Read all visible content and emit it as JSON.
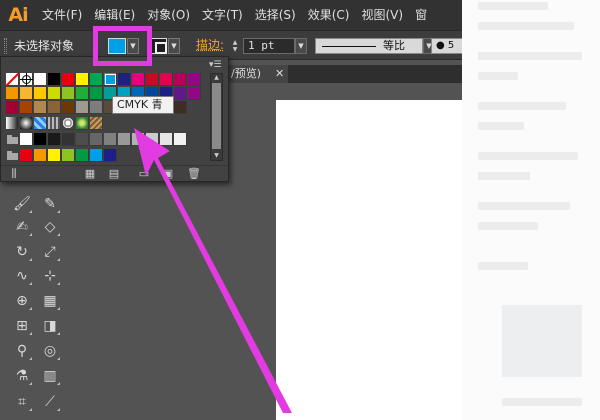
{
  "app": {
    "logo": "Ai"
  },
  "menubar": {
    "items": [
      "文件(F)",
      "编辑(E)",
      "对象(O)",
      "文字(T)",
      "选择(S)",
      "效果(C)",
      "视图(V)",
      "窗"
    ]
  },
  "controlbar": {
    "selection_status": "未选择对象",
    "fill_color": "#00a0e9",
    "stroke_label": "描边:",
    "stroke_weight": "1 pt",
    "profile_label": "等比",
    "brush_value": "● 5"
  },
  "document": {
    "tab_label": "/预览)",
    "close_glyph": "✕"
  },
  "tooltip": {
    "text": "CMYK 青"
  },
  "annotation_color": "#e33be2"
}
